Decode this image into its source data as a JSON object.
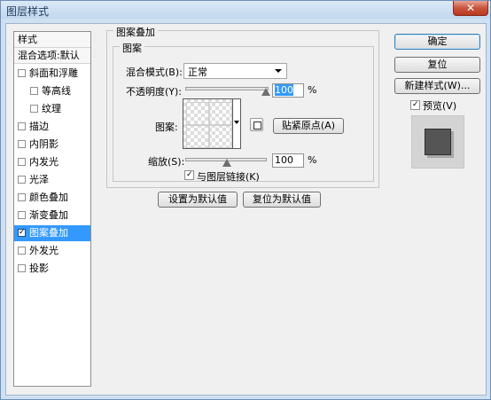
{
  "window": {
    "title": "图层样式"
  },
  "sidebar": {
    "header": "样式",
    "blend_default": "混合选项:默认",
    "items": [
      {
        "label": "斜面和浮雕",
        "checked": false
      },
      {
        "label": "等高线",
        "checked": false
      },
      {
        "label": "纹理",
        "checked": false
      },
      {
        "label": "描边",
        "checked": false
      },
      {
        "label": "内阴影",
        "checked": false
      },
      {
        "label": "内发光",
        "checked": false
      },
      {
        "label": "光泽",
        "checked": false
      },
      {
        "label": "颜色叠加",
        "checked": false
      },
      {
        "label": "渐变叠加",
        "checked": false
      },
      {
        "label": "图案叠加",
        "checked": true,
        "selected": true
      },
      {
        "label": "外发光",
        "checked": false
      },
      {
        "label": "投影",
        "checked": false
      }
    ]
  },
  "pattern_overlay": {
    "section_title": "图案叠加",
    "group_title": "图案",
    "blend_mode_label": "混合模式(B):",
    "blend_mode_value": "正常",
    "opacity_label": "不透明度(Y):",
    "opacity_value": "100",
    "opacity_unit": "%",
    "opacity_level": 1.0,
    "pattern_label": "图案:",
    "snap_origin_button": "贴紧原点(A)",
    "scale_label": "缩放(S):",
    "scale_value": "100",
    "scale_unit": "%",
    "scale_level": 0.5,
    "link_layer_label": "与图层链接(K)",
    "link_layer_checked": true,
    "make_default_button": "设置为默认值",
    "reset_default_button": "复位为默认值"
  },
  "actions": {
    "ok": "确定",
    "reset": "复位",
    "new_style": "新建样式(W)...",
    "preview_label": "预览(V)",
    "preview_checked": true
  },
  "colors": {
    "selection": "#3399ff",
    "title_bar": "#c2d7ee",
    "close_button": "#c9553e",
    "preview_tile": "#555555"
  }
}
